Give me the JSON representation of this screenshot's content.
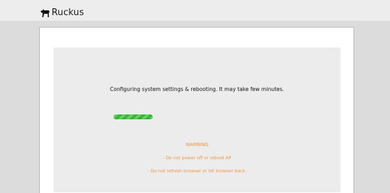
{
  "brand": {
    "name": "Ruckus",
    "logo_icon": "dog-logo-icon"
  },
  "status": {
    "message": "Configuring system settings & rebooting. It may take few minutes.",
    "progress_fraction": 0.15
  },
  "warning": {
    "title": "WARNING",
    "lines": [
      "- Do not power off or reboot AP",
      "- Do not refresh browser or hit browser back."
    ]
  },
  "colors": {
    "warning": "#f0953a",
    "progress": "#4cc94c",
    "background": "#dcdcdc"
  }
}
